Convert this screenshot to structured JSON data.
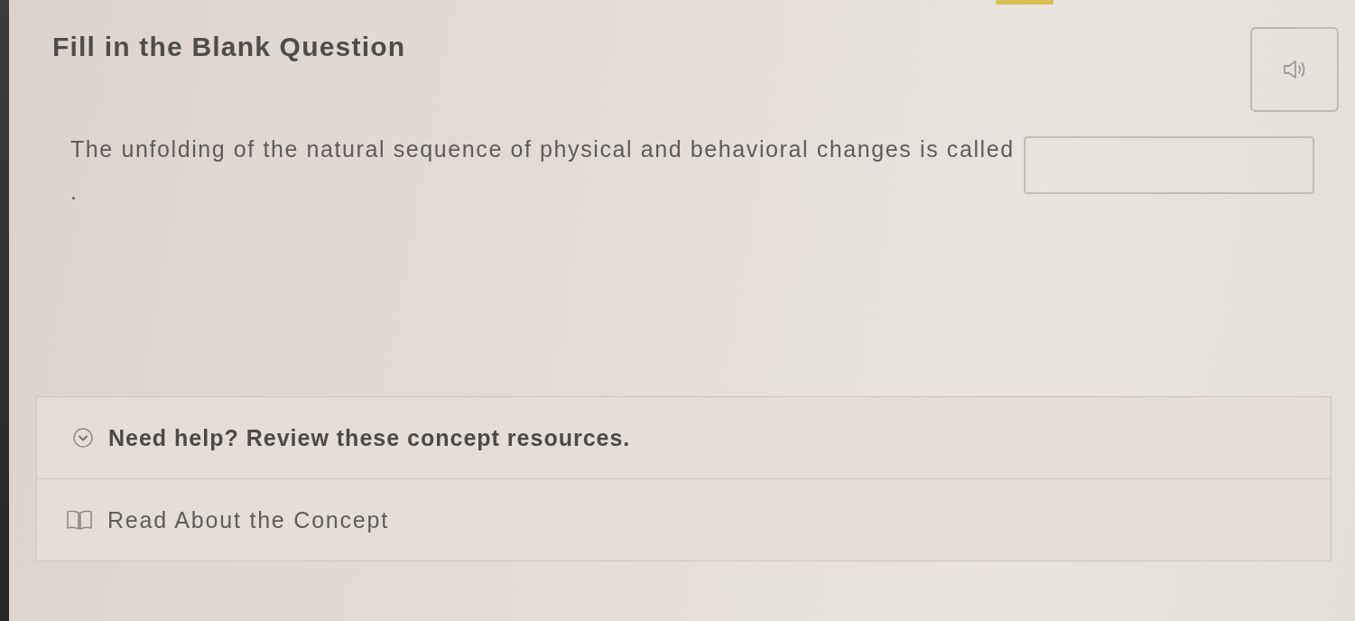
{
  "title": "Fill in the Blank Question",
  "question": {
    "text": "The unfolding of the natural sequence of physical and behavioral changes is called",
    "after_blank": "."
  },
  "help": {
    "heading": "Need help? Review these concept resources.",
    "expanded": true,
    "resources": [
      {
        "label": "Read About the Concept"
      }
    ]
  }
}
